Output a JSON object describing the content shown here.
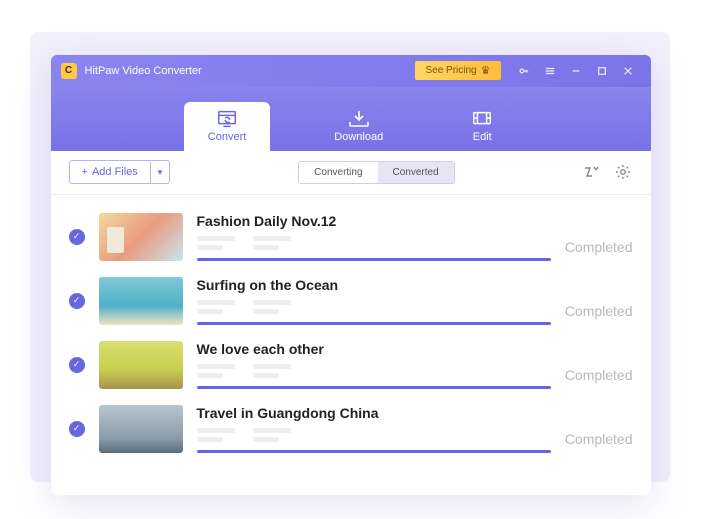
{
  "titlebar": {
    "app_name": "HitPaw Video Converter",
    "see_pricing": "See Pricing"
  },
  "tabs": {
    "convert": "Convert",
    "download": "Download",
    "edit": "Edit"
  },
  "toolbar": {
    "add_files": "Add Files",
    "segments": {
      "converting": "Converting",
      "converted": "Converted"
    }
  },
  "items": [
    {
      "title": "Fashion Daily Nov.12",
      "status": "Completed"
    },
    {
      "title": "Surfing on the Ocean",
      "status": "Completed"
    },
    {
      "title": "We love each other",
      "status": "Completed"
    },
    {
      "title": "Travel in Guangdong China",
      "status": "Completed"
    }
  ],
  "colors": {
    "accent": "#6b64e0"
  }
}
